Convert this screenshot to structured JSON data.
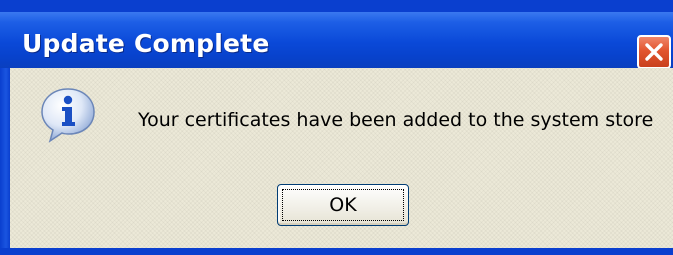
{
  "window": {
    "title": "Update Complete"
  },
  "message": {
    "text": "Your certificates have been added to the system store",
    "icon": "info-icon"
  },
  "buttons": {
    "ok_label": "OK"
  },
  "colors": {
    "title_bar": "#0a49d8",
    "client_background": "#ece9d8",
    "close_button": "#e2552f"
  }
}
